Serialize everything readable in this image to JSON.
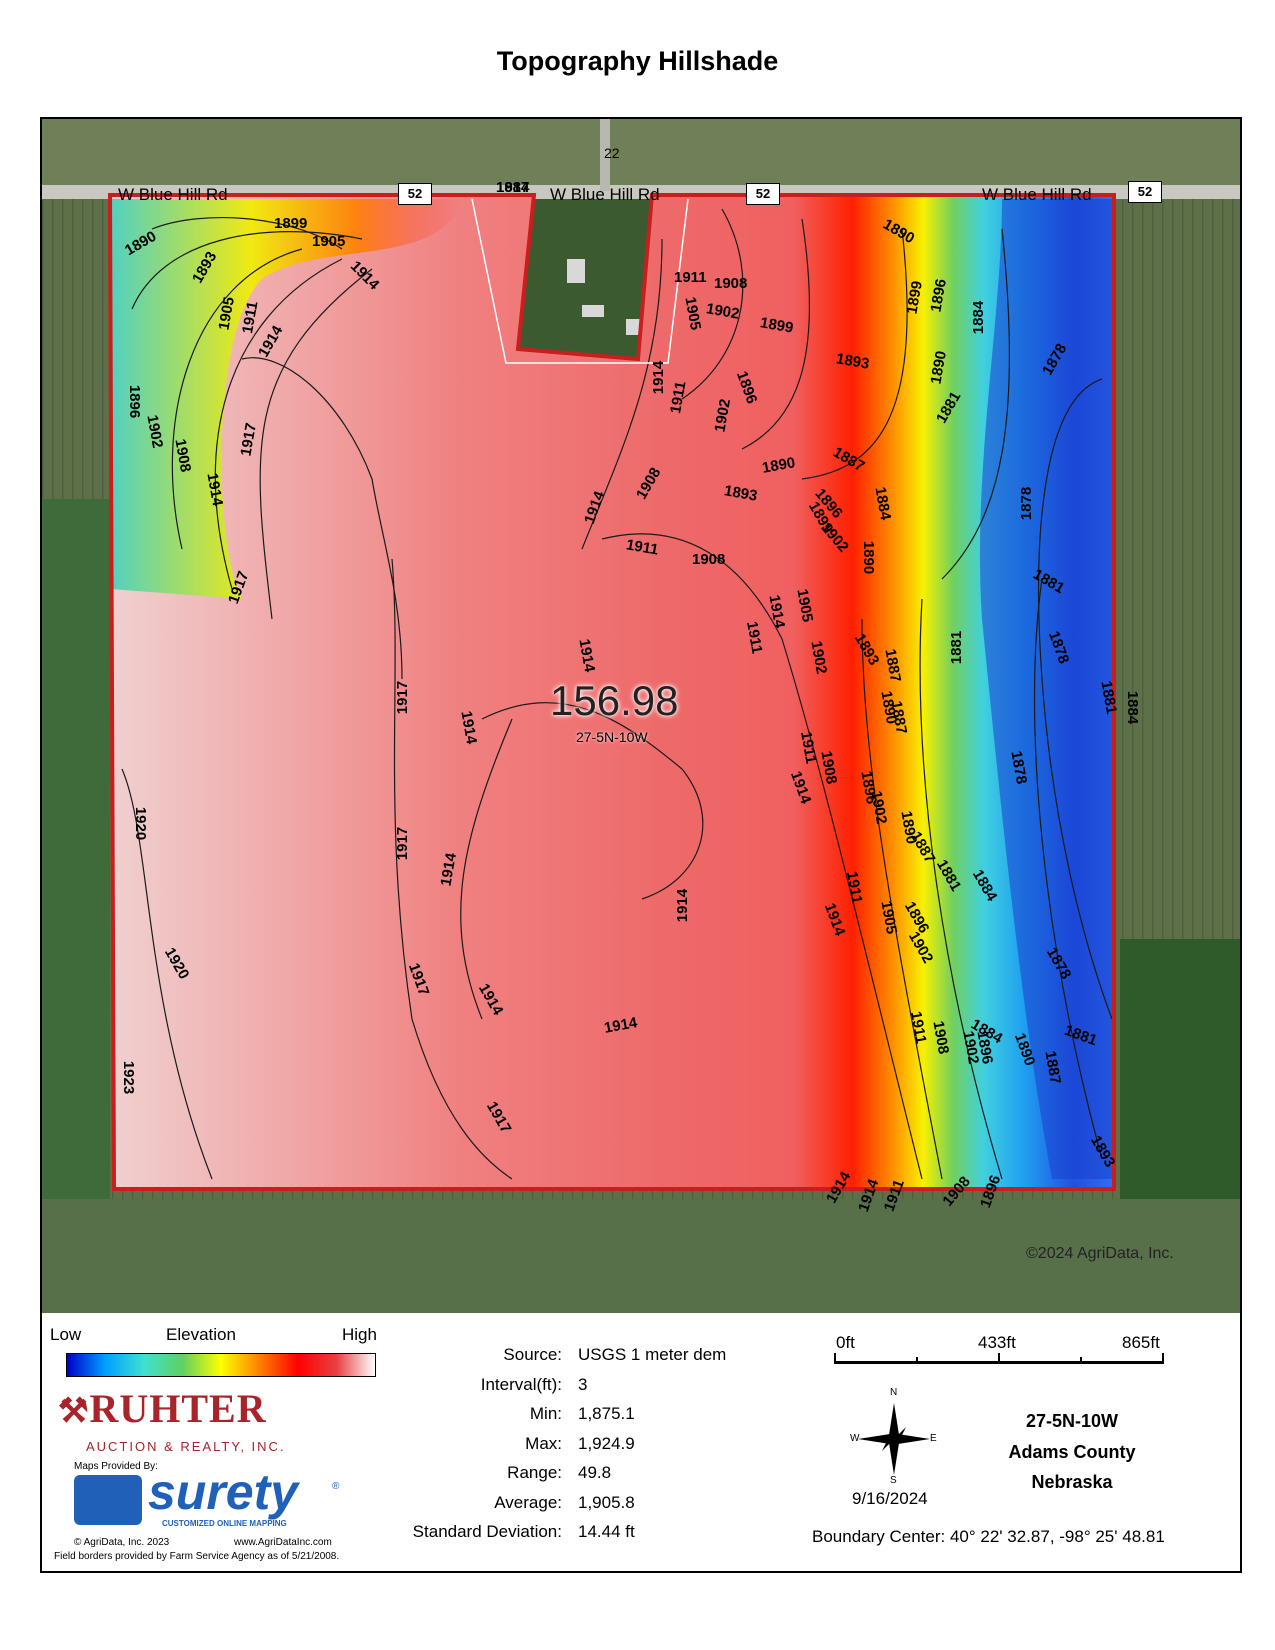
{
  "page": {
    "title": "Topography Hillshade"
  },
  "map": {
    "roads": [
      {
        "label": "W Blue Hill Rd"
      },
      {
        "label": "W Blue Hill Rd"
      },
      {
        "label": "W Blue Hill Rd"
      }
    ],
    "road_shields": [
      "52",
      "52",
      "52"
    ],
    "north_road_number": "22",
    "field_acres": "156.98",
    "field_section": "27-5N-10W",
    "copyright": "©2024 AgriData, Inc.",
    "contour_labels": [
      {
        "text": "1917"
      },
      {
        "text": "1890"
      },
      {
        "text": "1893"
      },
      {
        "text": "1899"
      },
      {
        "text": "1905"
      },
      {
        "text": "1914"
      },
      {
        "text": "1905"
      },
      {
        "text": "1911"
      },
      {
        "text": "1914"
      },
      {
        "text": "1896"
      },
      {
        "text": "1902"
      },
      {
        "text": "1908"
      },
      {
        "text": "1914"
      },
      {
        "text": "1917"
      },
      {
        "text": "1917"
      },
      {
        "text": "1890"
      },
      {
        "text": "1908"
      },
      {
        "text": "1911"
      },
      {
        "text": "1902"
      },
      {
        "text": "1899"
      },
      {
        "text": "1905"
      },
      {
        "text": "1899"
      },
      {
        "text": "1896"
      },
      {
        "text": "1884"
      },
      {
        "text": "1893"
      },
      {
        "text": "1890"
      },
      {
        "text": "1878"
      },
      {
        "text": "1914"
      },
      {
        "text": "1911"
      },
      {
        "text": "1896"
      },
      {
        "text": "1902"
      },
      {
        "text": "1881"
      },
      {
        "text": "1908"
      },
      {
        "text": "1914"
      },
      {
        "text": "1890"
      },
      {
        "text": "1887"
      },
      {
        "text": "1893"
      },
      {
        "text": "1896"
      },
      {
        "text": "1899"
      },
      {
        "text": "1902"
      },
      {
        "text": "1884"
      },
      {
        "text": "1878"
      },
      {
        "text": "1908"
      },
      {
        "text": "1911"
      },
      {
        "text": "1890"
      },
      {
        "text": "1881"
      },
      {
        "text": "1914"
      },
      {
        "text": "1911"
      },
      {
        "text": "1905"
      },
      {
        "text": "1902"
      },
      {
        "text": "1893"
      },
      {
        "text": "1887"
      },
      {
        "text": "1890"
      },
      {
        "text": "1881"
      },
      {
        "text": "1878"
      },
      {
        "text": "1917"
      },
      {
        "text": "1914"
      },
      {
        "text": "1914"
      },
      {
        "text": "1887"
      },
      {
        "text": "1881"
      },
      {
        "text": "1884"
      },
      {
        "text": "1911"
      },
      {
        "text": "1914"
      },
      {
        "text": "1908"
      },
      {
        "text": "1896"
      },
      {
        "text": "1902"
      },
      {
        "text": "1890"
      },
      {
        "text": "1878"
      },
      {
        "text": "1920"
      },
      {
        "text": "1917"
      },
      {
        "text": "1914"
      },
      {
        "text": "1914"
      },
      {
        "text": "1887"
      },
      {
        "text": "1881"
      },
      {
        "text": "1884"
      },
      {
        "text": "1911"
      },
      {
        "text": "1914"
      },
      {
        "text": "1905"
      },
      {
        "text": "1896"
      },
      {
        "text": "1902"
      },
      {
        "text": "1920"
      },
      {
        "text": "1917"
      },
      {
        "text": "1914"
      },
      {
        "text": "1914"
      },
      {
        "text": "1878"
      },
      {
        "text": "1881"
      },
      {
        "text": "1884"
      },
      {
        "text": "1911"
      },
      {
        "text": "1908"
      },
      {
        "text": "1896"
      },
      {
        "text": "1902"
      },
      {
        "text": "1890"
      },
      {
        "text": "1887"
      },
      {
        "text": "1923"
      },
      {
        "text": "1917"
      },
      {
        "text": "1914"
      },
      {
        "text": "1914"
      },
      {
        "text": "1911"
      },
      {
        "text": "1908"
      },
      {
        "text": "1896"
      },
      {
        "text": "1893"
      },
      {
        "text": "1884"
      }
    ]
  },
  "legend": {
    "low": "Low",
    "elevation": "Elevation",
    "high": "High",
    "stats": [
      {
        "key": "Source:",
        "value": "USGS 1 meter dem"
      },
      {
        "key": "Interval(ft):",
        "value": "3"
      },
      {
        "key": "Min:",
        "value": "1,875.1"
      },
      {
        "key": "Max:",
        "value": "1,924.9"
      },
      {
        "key": "Range:",
        "value": "49.8"
      },
      {
        "key": "Average:",
        "value": "1,905.8"
      },
      {
        "key": "Standard Deviation:",
        "value": "14.44 ft"
      }
    ],
    "scale": {
      "t0": "0ft",
      "t1": "433ft",
      "t2": "865ft"
    },
    "compass": {
      "n": "N",
      "s": "S",
      "e": "E",
      "w": "W"
    },
    "date": "9/16/2024",
    "location": {
      "line1": "27-5N-10W",
      "line2": "Adams County",
      "line3": "Nebraska"
    },
    "boundary_center": "Boundary Center: 40° 22' 32.87,  -98° 25' 48.81",
    "logo": {
      "ruhter": "RUHTER",
      "ruhter_sub": "AUCTION & REALTY, INC.",
      "maps_provided": "Maps Provided By:",
      "surety": "surety",
      "surety_reg": "®",
      "surety_sub": "CUSTOMIZED ONLINE MAPPING",
      "agridata": "© AgriData, Inc. 2023",
      "website": "www.AgriDataInc.com",
      "field_borders": "Field borders provided by Farm Service Agency as of 5/21/2008."
    }
  }
}
